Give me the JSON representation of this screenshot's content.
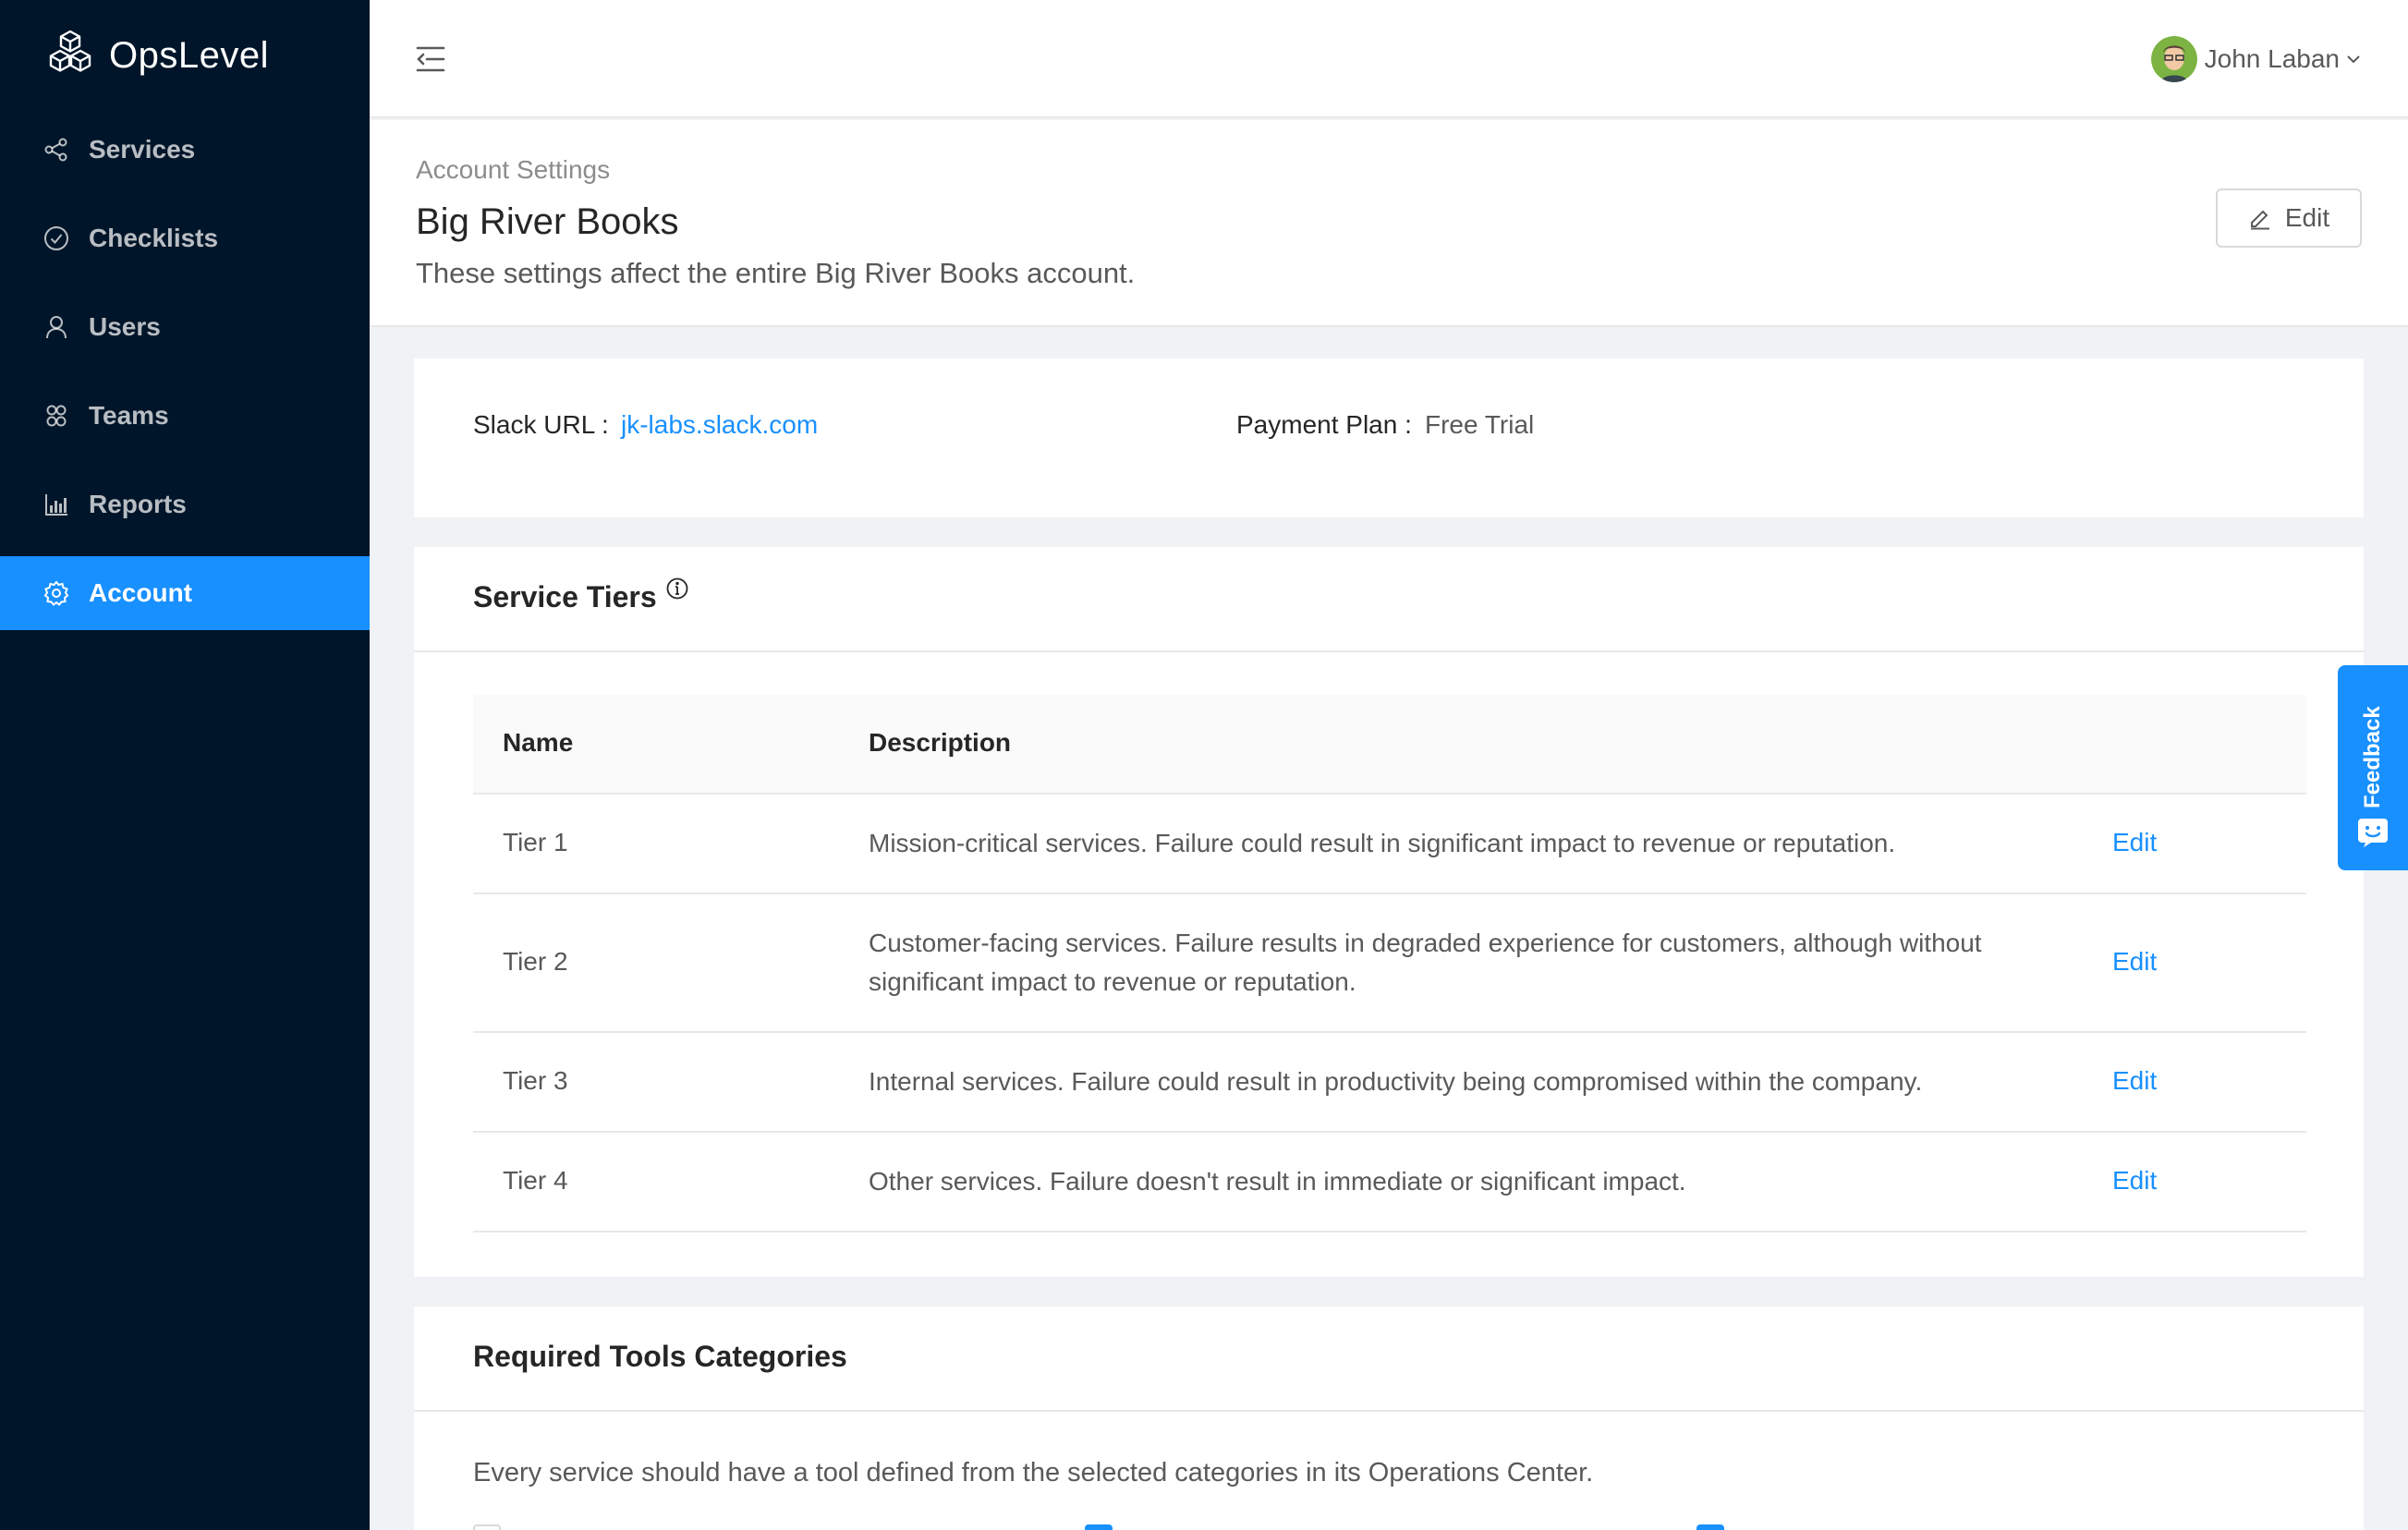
{
  "app": {
    "name": "OpsLevel",
    "accent_color": "#1890ff",
    "sidebar_color": "#001529"
  },
  "sidebar": {
    "items": [
      {
        "label": "Services",
        "icon": "share-nodes-icon"
      },
      {
        "label": "Checklists",
        "icon": "check-circle-icon"
      },
      {
        "label": "Users",
        "icon": "user-icon"
      },
      {
        "label": "Teams",
        "icon": "team-icon"
      },
      {
        "label": "Reports",
        "icon": "bar-chart-icon"
      },
      {
        "label": "Account",
        "icon": "gear-icon",
        "active": true
      }
    ]
  },
  "header": {
    "menu_icon": "menu-fold-icon",
    "user_name": "John Laban"
  },
  "page": {
    "breadcrumb": "Account Settings",
    "title": "Big River Books",
    "subtitle": "These settings affect the entire Big River Books account.",
    "edit_label": "Edit"
  },
  "info": {
    "slack_label": "Slack URL :",
    "slack_value": "jk-labs.slack.com",
    "plan_label": "Payment Plan :",
    "plan_value": "Free Trial"
  },
  "service_tiers": {
    "title": "Service Tiers",
    "columns": [
      "Name",
      "Description"
    ],
    "rows": [
      {
        "name": "Tier 1",
        "description": "Mission-critical services. Failure could result in significant impact to revenue or reputation.",
        "action": "Edit"
      },
      {
        "name": "Tier 2",
        "description": "Customer-facing services. Failure results in degraded experience for customers, although without significant impact to revenue or reputation.",
        "action": "Edit"
      },
      {
        "name": "Tier 3",
        "description": "Internal services. Failure could result in productivity being compromised within the company.",
        "action": "Edit"
      },
      {
        "name": "Tier 4",
        "description": "Other services. Failure doesn't result in immediate or significant impact.",
        "action": "Edit"
      }
    ]
  },
  "required_tools": {
    "title": "Required Tools Categories",
    "description": "Every service should have a tool defined from the selected categories in its Operations Center."
  },
  "feedback": {
    "label": "Feedback"
  }
}
